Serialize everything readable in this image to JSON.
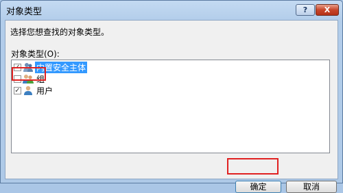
{
  "window": {
    "title": "对象类型",
    "help_label": "?",
    "close_label": "X"
  },
  "dialog": {
    "prompt": "选择您想查找的对象类型。",
    "list_label": "对象类型(O):",
    "items": [
      {
        "label": "内置安全主体",
        "checked": true,
        "selected": true,
        "icon": "security-principal-icon"
      },
      {
        "label": "组",
        "checked": false,
        "selected": false,
        "icon": "group-icon"
      },
      {
        "label": "用户",
        "checked": true,
        "selected": false,
        "icon": "user-icon"
      }
    ],
    "ok_label": "确定",
    "cancel_label": "取消"
  },
  "colors": {
    "selection": "#3399ff",
    "annotation_outline": "#e02020",
    "title_bar": "#c4daf2"
  }
}
